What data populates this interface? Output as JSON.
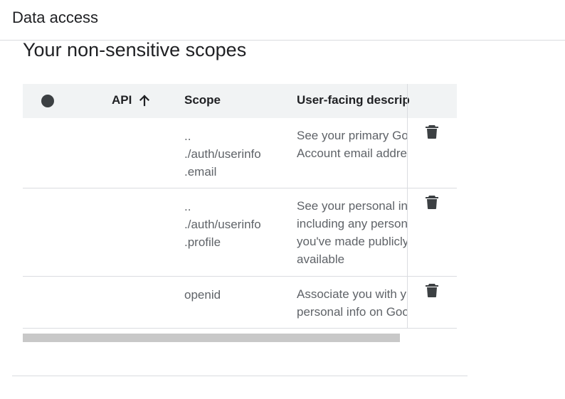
{
  "header": {
    "title": "Data access"
  },
  "section": {
    "title": "Your non-sensitive scopes"
  },
  "table": {
    "columns": {
      "select": "",
      "api": "API",
      "scope": "Scope",
      "description": "User-facing descrip"
    },
    "sort": {
      "column": "API",
      "direction": "ascending",
      "icon": "arrow-up-icon"
    },
    "rows": [
      {
        "api": "",
        "scope_lines": [
          "..",
          "./auth/userinfo",
          ".email"
        ],
        "description_lines": [
          "See your primary Go",
          "Account email addre"
        ],
        "action_icon": "trash-icon"
      },
      {
        "api": "",
        "scope_lines": [
          "..",
          "./auth/userinfo",
          ".profile"
        ],
        "description_lines": [
          "See your personal in",
          "including any person",
          "you've made publicly",
          "available"
        ],
        "action_icon": "trash-icon"
      },
      {
        "api": "",
        "scope_lines": [
          "openid"
        ],
        "description_lines": [
          "Associate you with y",
          "personal info on Goo"
        ],
        "action_icon": "trash-icon"
      }
    ]
  },
  "colors": {
    "header_bg": "#f1f3f4",
    "divider": "#dadce0",
    "text_primary": "#202124",
    "text_secondary": "#5f6368",
    "icon": "#3c4043"
  }
}
